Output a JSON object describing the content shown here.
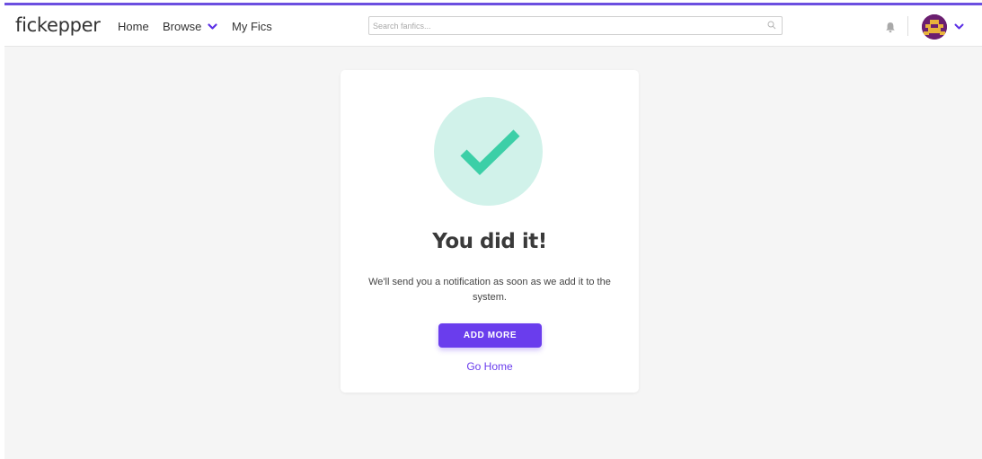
{
  "header": {
    "logo": "fickepper",
    "nav": {
      "home": "Home",
      "browse": "Browse",
      "my_fics": "My Fics"
    },
    "search": {
      "placeholder": "Search fanfics..."
    },
    "accent_color": "#6b4fe0"
  },
  "confirmation": {
    "title": "You did it!",
    "message": "We'll send you a notification as soon as we add it to the system.",
    "primary_button": "ADD MORE",
    "secondary_link": "Go Home",
    "check_color": "#3ccfa7",
    "button_color": "#6a3ded"
  },
  "icons": {
    "browse_dropdown": "chevron-down-icon",
    "search": "search-icon",
    "notifications": "bell-icon",
    "account_dropdown": "chevron-down-icon",
    "success": "checkmark-icon"
  }
}
